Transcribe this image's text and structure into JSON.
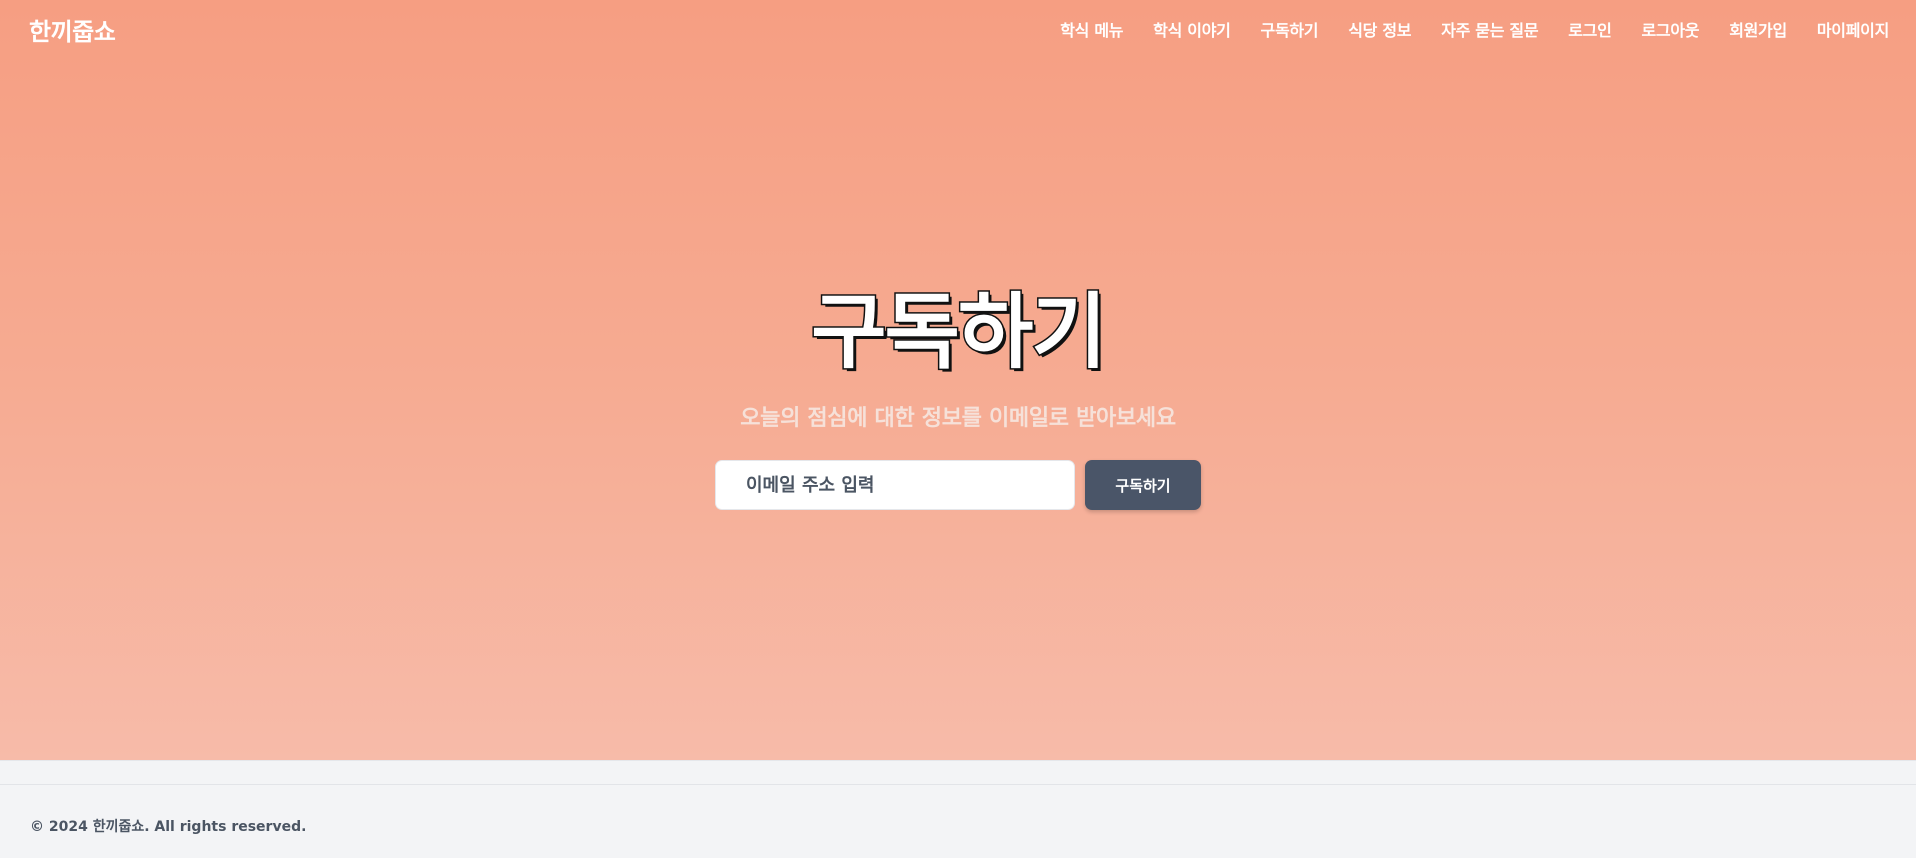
{
  "header": {
    "logo": "한끼줍쇼",
    "nav": [
      {
        "label": "학식 메뉴"
      },
      {
        "label": "학식 이야기"
      },
      {
        "label": "구독하기"
      },
      {
        "label": "식당 정보"
      },
      {
        "label": "자주 묻는 질문"
      },
      {
        "label": "로그인"
      },
      {
        "label": "로그아웃"
      },
      {
        "label": "회원가입"
      },
      {
        "label": "마이페이지"
      }
    ]
  },
  "hero": {
    "title": "구독하기",
    "subtitle": "오늘의 점심에 대한 정보를 이메일로 받아보세요",
    "email_placeholder": "이메일 주소 입력",
    "email_value": "",
    "subscribe_label": "구독하기"
  },
  "footer": {
    "copyright": "© 2024 한끼줍쇼. All rights reserved."
  },
  "colors": {
    "hero_gradient_top": "#f69e82",
    "hero_gradient_bottom": "#f7bba9",
    "button_bg": "#4a5568",
    "footer_bg": "#f3f4f6"
  }
}
